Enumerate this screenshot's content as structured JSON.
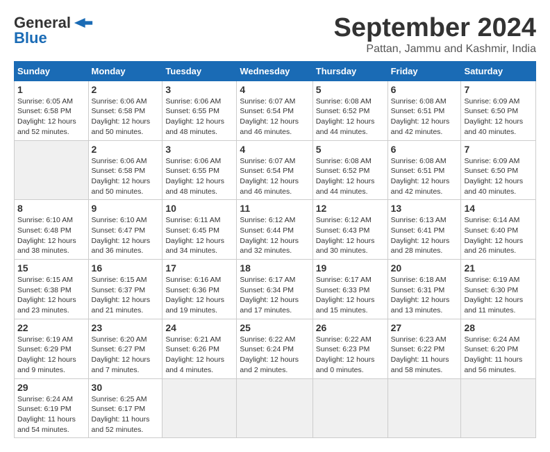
{
  "header": {
    "logo_general": "General",
    "logo_blue": "Blue",
    "month": "September 2024",
    "location": "Pattan, Jammu and Kashmir, India"
  },
  "calendar": {
    "days_of_week": [
      "Sunday",
      "Monday",
      "Tuesday",
      "Wednesday",
      "Thursday",
      "Friday",
      "Saturday"
    ],
    "weeks": [
      [
        null,
        {
          "day": 2,
          "sunrise": "Sunrise: 6:06 AM",
          "sunset": "Sunset: 6:58 PM",
          "daylight": "Daylight: 12 hours and 50 minutes."
        },
        {
          "day": 3,
          "sunrise": "Sunrise: 6:06 AM",
          "sunset": "Sunset: 6:55 PM",
          "daylight": "Daylight: 12 hours and 48 minutes."
        },
        {
          "day": 4,
          "sunrise": "Sunrise: 6:07 AM",
          "sunset": "Sunset: 6:54 PM",
          "daylight": "Daylight: 12 hours and 46 minutes."
        },
        {
          "day": 5,
          "sunrise": "Sunrise: 6:08 AM",
          "sunset": "Sunset: 6:52 PM",
          "daylight": "Daylight: 12 hours and 44 minutes."
        },
        {
          "day": 6,
          "sunrise": "Sunrise: 6:08 AM",
          "sunset": "Sunset: 6:51 PM",
          "daylight": "Daylight: 12 hours and 42 minutes."
        },
        {
          "day": 7,
          "sunrise": "Sunrise: 6:09 AM",
          "sunset": "Sunset: 6:50 PM",
          "daylight": "Daylight: 12 hours and 40 minutes."
        }
      ],
      [
        {
          "day": 8,
          "sunrise": "Sunrise: 6:10 AM",
          "sunset": "Sunset: 6:48 PM",
          "daylight": "Daylight: 12 hours and 38 minutes."
        },
        {
          "day": 9,
          "sunrise": "Sunrise: 6:10 AM",
          "sunset": "Sunset: 6:47 PM",
          "daylight": "Daylight: 12 hours and 36 minutes."
        },
        {
          "day": 10,
          "sunrise": "Sunrise: 6:11 AM",
          "sunset": "Sunset: 6:45 PM",
          "daylight": "Daylight: 12 hours and 34 minutes."
        },
        {
          "day": 11,
          "sunrise": "Sunrise: 6:12 AM",
          "sunset": "Sunset: 6:44 PM",
          "daylight": "Daylight: 12 hours and 32 minutes."
        },
        {
          "day": 12,
          "sunrise": "Sunrise: 6:12 AM",
          "sunset": "Sunset: 6:43 PM",
          "daylight": "Daylight: 12 hours and 30 minutes."
        },
        {
          "day": 13,
          "sunrise": "Sunrise: 6:13 AM",
          "sunset": "Sunset: 6:41 PM",
          "daylight": "Daylight: 12 hours and 28 minutes."
        },
        {
          "day": 14,
          "sunrise": "Sunrise: 6:14 AM",
          "sunset": "Sunset: 6:40 PM",
          "daylight": "Daylight: 12 hours and 26 minutes."
        }
      ],
      [
        {
          "day": 15,
          "sunrise": "Sunrise: 6:15 AM",
          "sunset": "Sunset: 6:38 PM",
          "daylight": "Daylight: 12 hours and 23 minutes."
        },
        {
          "day": 16,
          "sunrise": "Sunrise: 6:15 AM",
          "sunset": "Sunset: 6:37 PM",
          "daylight": "Daylight: 12 hours and 21 minutes."
        },
        {
          "day": 17,
          "sunrise": "Sunrise: 6:16 AM",
          "sunset": "Sunset: 6:36 PM",
          "daylight": "Daylight: 12 hours and 19 minutes."
        },
        {
          "day": 18,
          "sunrise": "Sunrise: 6:17 AM",
          "sunset": "Sunset: 6:34 PM",
          "daylight": "Daylight: 12 hours and 17 minutes."
        },
        {
          "day": 19,
          "sunrise": "Sunrise: 6:17 AM",
          "sunset": "Sunset: 6:33 PM",
          "daylight": "Daylight: 12 hours and 15 minutes."
        },
        {
          "day": 20,
          "sunrise": "Sunrise: 6:18 AM",
          "sunset": "Sunset: 6:31 PM",
          "daylight": "Daylight: 12 hours and 13 minutes."
        },
        {
          "day": 21,
          "sunrise": "Sunrise: 6:19 AM",
          "sunset": "Sunset: 6:30 PM",
          "daylight": "Daylight: 12 hours and 11 minutes."
        }
      ],
      [
        {
          "day": 22,
          "sunrise": "Sunrise: 6:19 AM",
          "sunset": "Sunset: 6:29 PM",
          "daylight": "Daylight: 12 hours and 9 minutes."
        },
        {
          "day": 23,
          "sunrise": "Sunrise: 6:20 AM",
          "sunset": "Sunset: 6:27 PM",
          "daylight": "Daylight: 12 hours and 7 minutes."
        },
        {
          "day": 24,
          "sunrise": "Sunrise: 6:21 AM",
          "sunset": "Sunset: 6:26 PM",
          "daylight": "Daylight: 12 hours and 4 minutes."
        },
        {
          "day": 25,
          "sunrise": "Sunrise: 6:22 AM",
          "sunset": "Sunset: 6:24 PM",
          "daylight": "Daylight: 12 hours and 2 minutes."
        },
        {
          "day": 26,
          "sunrise": "Sunrise: 6:22 AM",
          "sunset": "Sunset: 6:23 PM",
          "daylight": "Daylight: 12 hours and 0 minutes."
        },
        {
          "day": 27,
          "sunrise": "Sunrise: 6:23 AM",
          "sunset": "Sunset: 6:22 PM",
          "daylight": "Daylight: 11 hours and 58 minutes."
        },
        {
          "day": 28,
          "sunrise": "Sunrise: 6:24 AM",
          "sunset": "Sunset: 6:20 PM",
          "daylight": "Daylight: 11 hours and 56 minutes."
        }
      ],
      [
        {
          "day": 29,
          "sunrise": "Sunrise: 6:24 AM",
          "sunset": "Sunset: 6:19 PM",
          "daylight": "Daylight: 11 hours and 54 minutes."
        },
        {
          "day": 30,
          "sunrise": "Sunrise: 6:25 AM",
          "sunset": "Sunset: 6:17 PM",
          "daylight": "Daylight: 11 hours and 52 minutes."
        },
        null,
        null,
        null,
        null,
        null
      ]
    ],
    "week0_day1": {
      "day": 1,
      "sunrise": "Sunrise: 6:05 AM",
      "sunset": "Sunset: 6:58 PM",
      "daylight": "Daylight: 12 hours and 52 minutes."
    }
  }
}
